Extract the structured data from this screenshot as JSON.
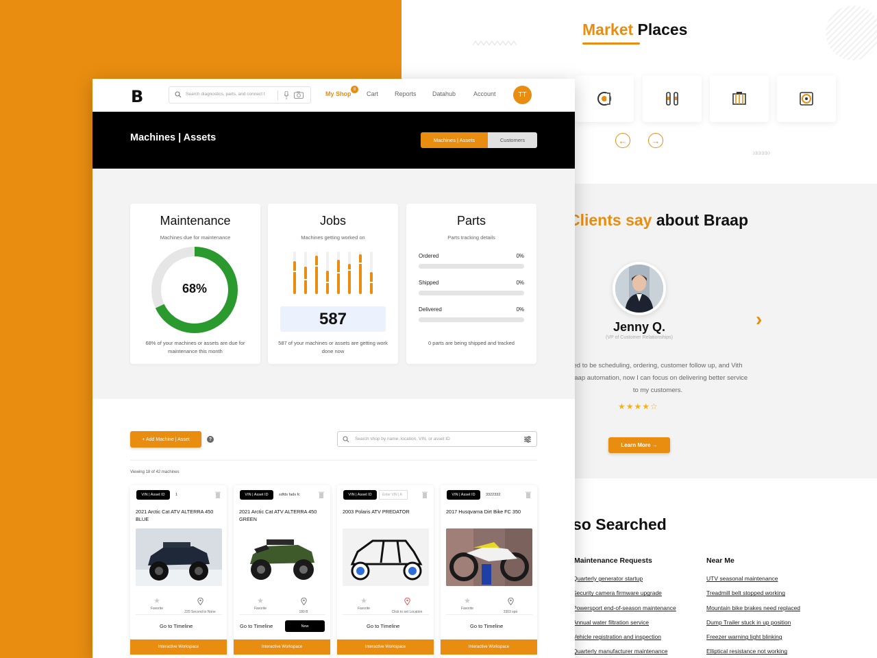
{
  "background_page": {
    "marketplaces_title_accent": "Market",
    "marketplaces_title_rest": " Places",
    "clients_title_accent": "Clients say",
    "clients_title_rest": " about Braap",
    "testimonial": {
      "name": "Jenny Q.",
      "role": "(VP of Customer Relationships)",
      "text": "ed to be scheduling, ordering, customer follow up, and Vith Braap automation, now I can focus on delivering better service to my customers.",
      "stars": "★★★★☆",
      "next": "›"
    },
    "learn_more": "Learn More →",
    "also_searched_title": "so Searched",
    "columns": [
      {
        "heading": "Maintenance Requests",
        "links": [
          "Quarterly generator startup",
          "Security camera firmware upgrade",
          "Powersport end-of-season maintenance",
          "Annual water filtration service",
          "Vehicle registration and inspection",
          "Quarterly manufacturer maintenance"
        ]
      },
      {
        "heading": "Near Me",
        "links": [
          "UTV seasonal maintenance",
          "Treadmill belt stopped working",
          "Mountain bike brakes need replaced",
          "Dump Trailer stuck in up position",
          "Freezer warning light blinking",
          "Elliptical resistance not working"
        ]
      }
    ],
    "prev_arrow": "←",
    "next_arrow": "→",
    "chevrons": "»»»»»"
  },
  "app": {
    "logo": "B",
    "search_placeholder": "Search diagnostics, parts, and connect t",
    "nav": {
      "my_shop": "My Shop",
      "my_shop_badge": "8",
      "cart": "Cart",
      "reports": "Reports",
      "datahub": "Datahub",
      "account": "Account"
    },
    "user_initials": "TT",
    "hero_title": "Machines | Assets",
    "toggle": {
      "active": "Machines | Assets",
      "inactive": "Customers"
    },
    "maintenance": {
      "title": "Maintenance",
      "subtitle": "Machines due for maintenance",
      "percent_label": "68%",
      "percent_value": 0.68,
      "footer": "68% of your machines or assets are due for maintenance this month"
    },
    "jobs": {
      "title": "Jobs",
      "subtitle": "Machines getting worked on",
      "count": "587",
      "footer": "587 of your machines or assets are getting work done now"
    },
    "parts": {
      "title": "Parts",
      "subtitle": "Parts tracking details",
      "rows": [
        {
          "label": "Ordered",
          "pct": "0%"
        },
        {
          "label": "Shipped",
          "pct": "0%"
        },
        {
          "label": "Delivered",
          "pct": "0%"
        }
      ],
      "footer": "0 parts are being shipped and tracked"
    },
    "add_button": "+ Add Machine | Asset",
    "help": "?",
    "shop_search_placeholder": "Search shop by name, location, VIN, or asset ID",
    "viewing": "Viewing 18 of 42 machines",
    "machines": [
      {
        "vin_label": "VIN | Asset ID",
        "vin_value": "1",
        "name": "2021 Arctic Cat ATV ALTERRA 450 BLUE",
        "favorite": "Favorite",
        "location": "220 Second to None",
        "timeline": "Go to Timeline",
        "workspace": "Interactive Workspace"
      },
      {
        "vin_label": "VIN | Asset ID",
        "vin_value": "sdfds fads fc",
        "name": "2021 Arctic Cat ATV ALTERRA 450 GREEN",
        "favorite": "Favorite",
        "location": "180 B",
        "timeline": "Go to Timeline",
        "new_label": "New",
        "workspace": "Interactive Workspace"
      },
      {
        "vin_label": "VIN | Asset ID",
        "vin_placeholder": "Enter VIN | A",
        "name": "2003 Polaris ATV PREDATOR",
        "favorite": "Favorite",
        "location": "Click to set Location",
        "timeline": "Go to Timeline",
        "workspace": "Interactive Workspace"
      },
      {
        "vin_label": "VIN | Asset ID",
        "vin_value": "3322332",
        "name": "2017 Husqvarna Dirt Bike FC 350",
        "favorite": "Favorite",
        "location": "3303 spo",
        "timeline": "Go to Timeline",
        "workspace": "Interactive Workspace"
      }
    ]
  },
  "colors": {
    "accent": "#e88d10",
    "donut_green": "#2a9a2e",
    "dark": "#000000"
  }
}
